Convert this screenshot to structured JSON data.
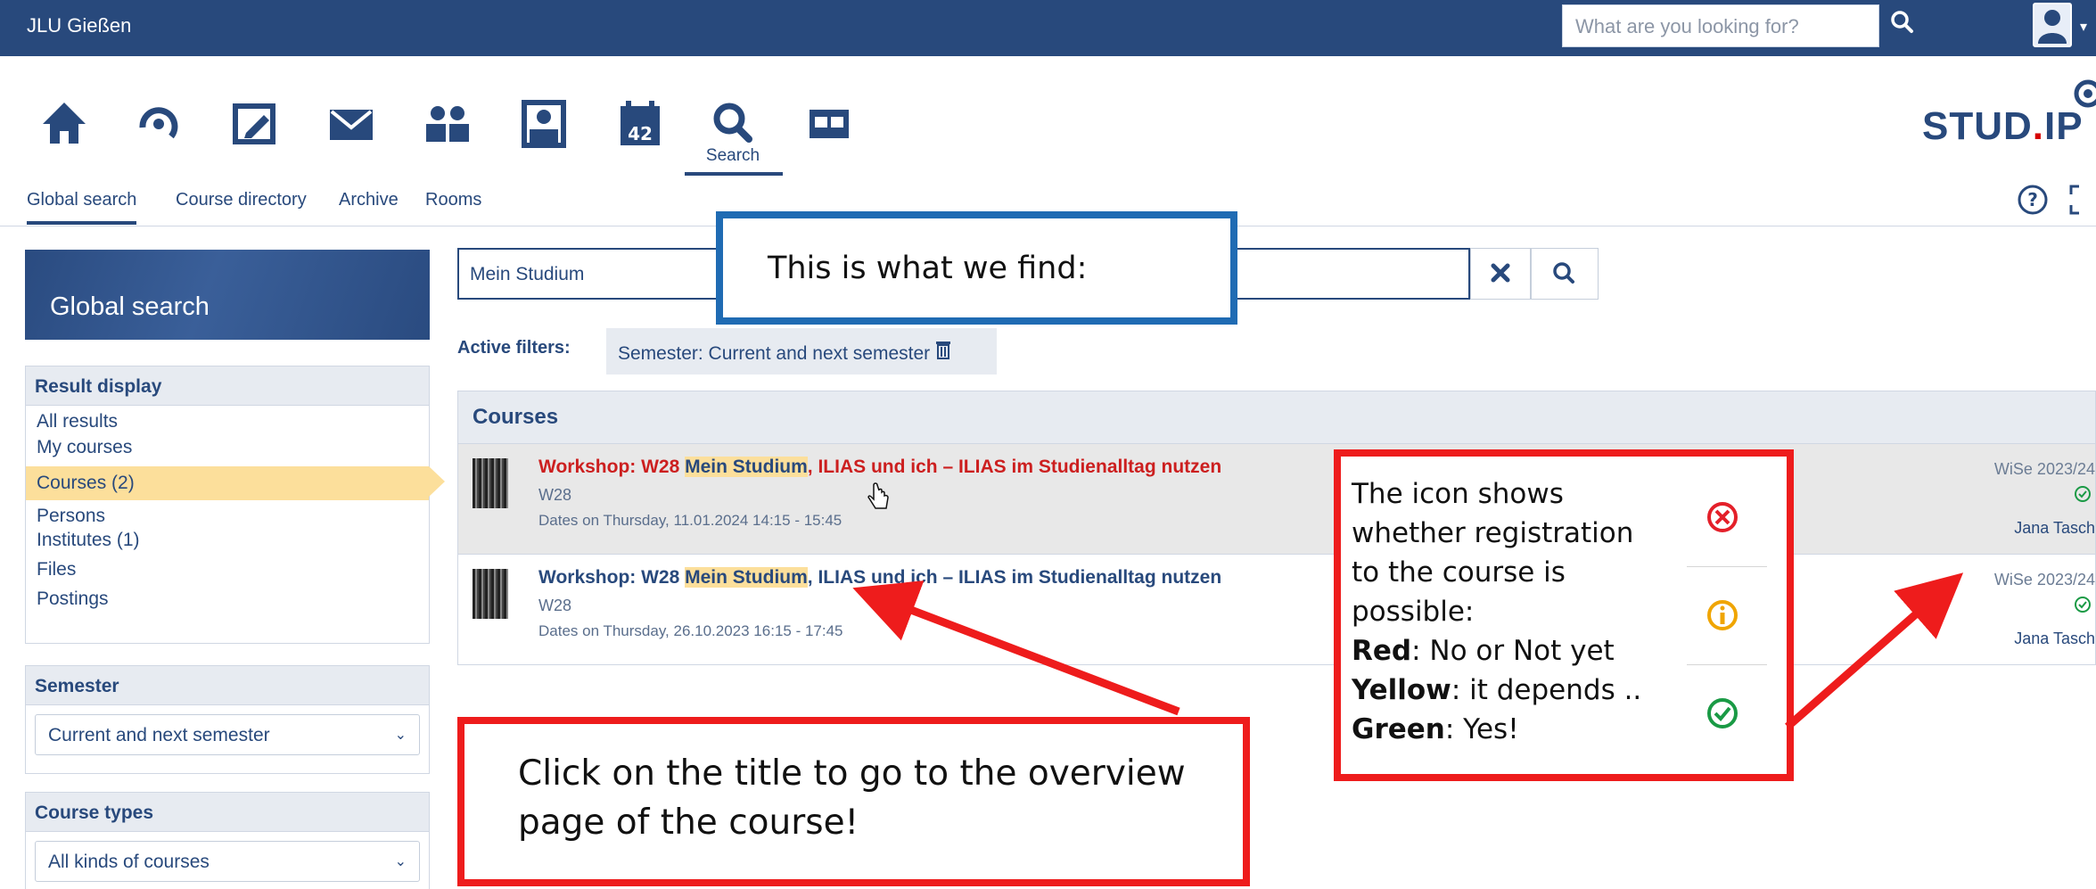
{
  "topbar": {
    "brand": "JLU Gießen",
    "search_placeholder": "What are you looking for?"
  },
  "navbar": {
    "active_label": "Search",
    "logo_text": "STUD",
    "logo_dot": ".",
    "logo_tail": "IP"
  },
  "subnav": {
    "tabs": [
      "Global search",
      "Course directory",
      "Archive",
      "Rooms"
    ]
  },
  "sidebar": {
    "title": "Global search",
    "result_display": {
      "heading": "Result display",
      "items": [
        "All results",
        "My courses",
        "Courses (2)",
        "Persons",
        "Institutes (1)",
        "Files",
        "Postings"
      ]
    },
    "semester": {
      "heading": "Semester",
      "selected": "Current and next semester"
    },
    "course_types": {
      "heading": "Course types",
      "selected": "All kinds of courses"
    }
  },
  "search": {
    "value": "Mein Studium"
  },
  "filters": {
    "label": "Active filters:",
    "chip": "Semester: Current and next semester"
  },
  "results": {
    "heading": "Courses",
    "rows": [
      {
        "title_pre": "Workshop: W28 ",
        "title_hl": "Mein Studium",
        "title_post": ", ILIAS und ich – ILIAS im Studienalltag nutzen",
        "number": "W28",
        "dates": "Dates on Thursday, 11.01.2024 14:15 - 15:45",
        "semester": "WiSe 2023/24",
        "lecturer": "Jana Tasch"
      },
      {
        "title_pre": "Workshop: W28 ",
        "title_hl": "Mein Studium",
        "title_post": ", ILIAS und ich – ILIAS im Studienalltag nutzen",
        "number": "W28",
        "dates": "Dates on Thursday, 26.10.2023 16:15 - 17:45",
        "semester": "WiSe 2023/24",
        "lecturer": "Jana Tasch"
      }
    ]
  },
  "annotations": {
    "find": "This is what we find:",
    "click": "Click on the title to go to the overview page of the course!",
    "icon_intro": "The icon shows whether registration to the course is possible:",
    "red_label": "Red",
    "red_text": ": No or Not yet",
    "yellow_label": "Yellow",
    "yellow_text": ": it depends ..",
    "green_label": "Green",
    "green_text": ": Yes!"
  },
  "colors": {
    "primary": "#28497c",
    "highlight": "#fcdf9b",
    "red": "#ee1c1c",
    "blue_callout": "#1f6bb3",
    "status_red": "#e4202a",
    "status_yellow": "#f0a500",
    "status_green": "#1a9a45"
  }
}
